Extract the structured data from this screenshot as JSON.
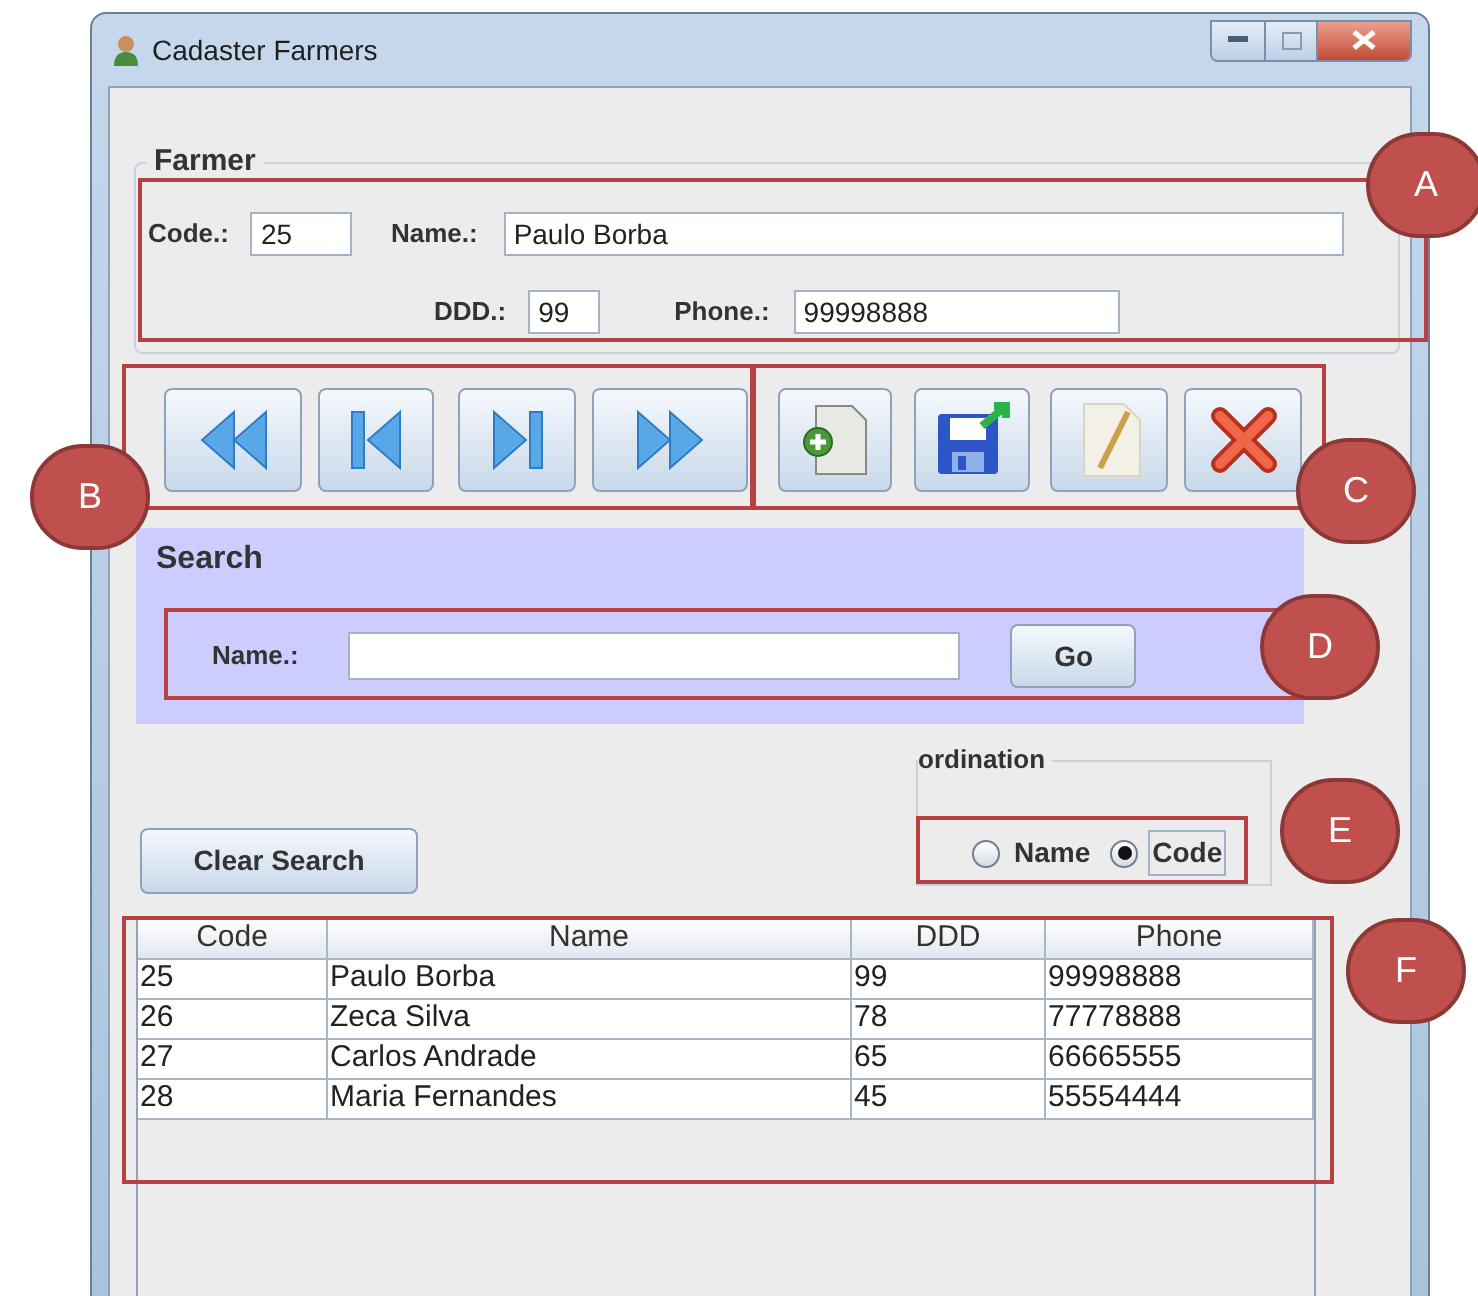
{
  "window": {
    "title": "Cadaster Farmers"
  },
  "farmer": {
    "title": "Farmer",
    "code": {
      "label": "Code.:",
      "value": "25"
    },
    "name": {
      "label": "Name.:",
      "value": "Paulo Borba"
    },
    "ddd": {
      "label": "DDD.:",
      "value": "99"
    },
    "phone": {
      "label": "Phone.:",
      "value": "99998888"
    }
  },
  "navigation_buttons": [
    {
      "kind": "first"
    },
    {
      "kind": "previous"
    },
    {
      "kind": "next"
    },
    {
      "kind": "last"
    }
  ],
  "action_buttons": [
    {
      "kind": "new"
    },
    {
      "kind": "save"
    },
    {
      "kind": "edit"
    },
    {
      "kind": "delete"
    }
  ],
  "search": {
    "title": "Search",
    "label": "Name.:",
    "button": "Go"
  },
  "ordination": {
    "title": "ordination",
    "options": [
      {
        "label": "Name",
        "selected": false
      },
      {
        "label": "Code",
        "selected": true
      }
    ]
  },
  "clear_button": "Clear Search",
  "table": {
    "columns": [
      "Code",
      "Name",
      "DDD",
      "Phone"
    ],
    "rows": [
      [
        "25",
        "Paulo Borba",
        "99",
        "99998888"
      ],
      [
        "26",
        "Zeca Silva",
        "78",
        "77778888"
      ],
      [
        "27",
        "Carlos Andrade",
        "65",
        "66665555"
      ],
      [
        "28",
        "Maria Fernandes",
        "45",
        "55554444"
      ]
    ]
  },
  "annotations": [
    "A",
    "B",
    "C",
    "D",
    "E",
    "F"
  ]
}
